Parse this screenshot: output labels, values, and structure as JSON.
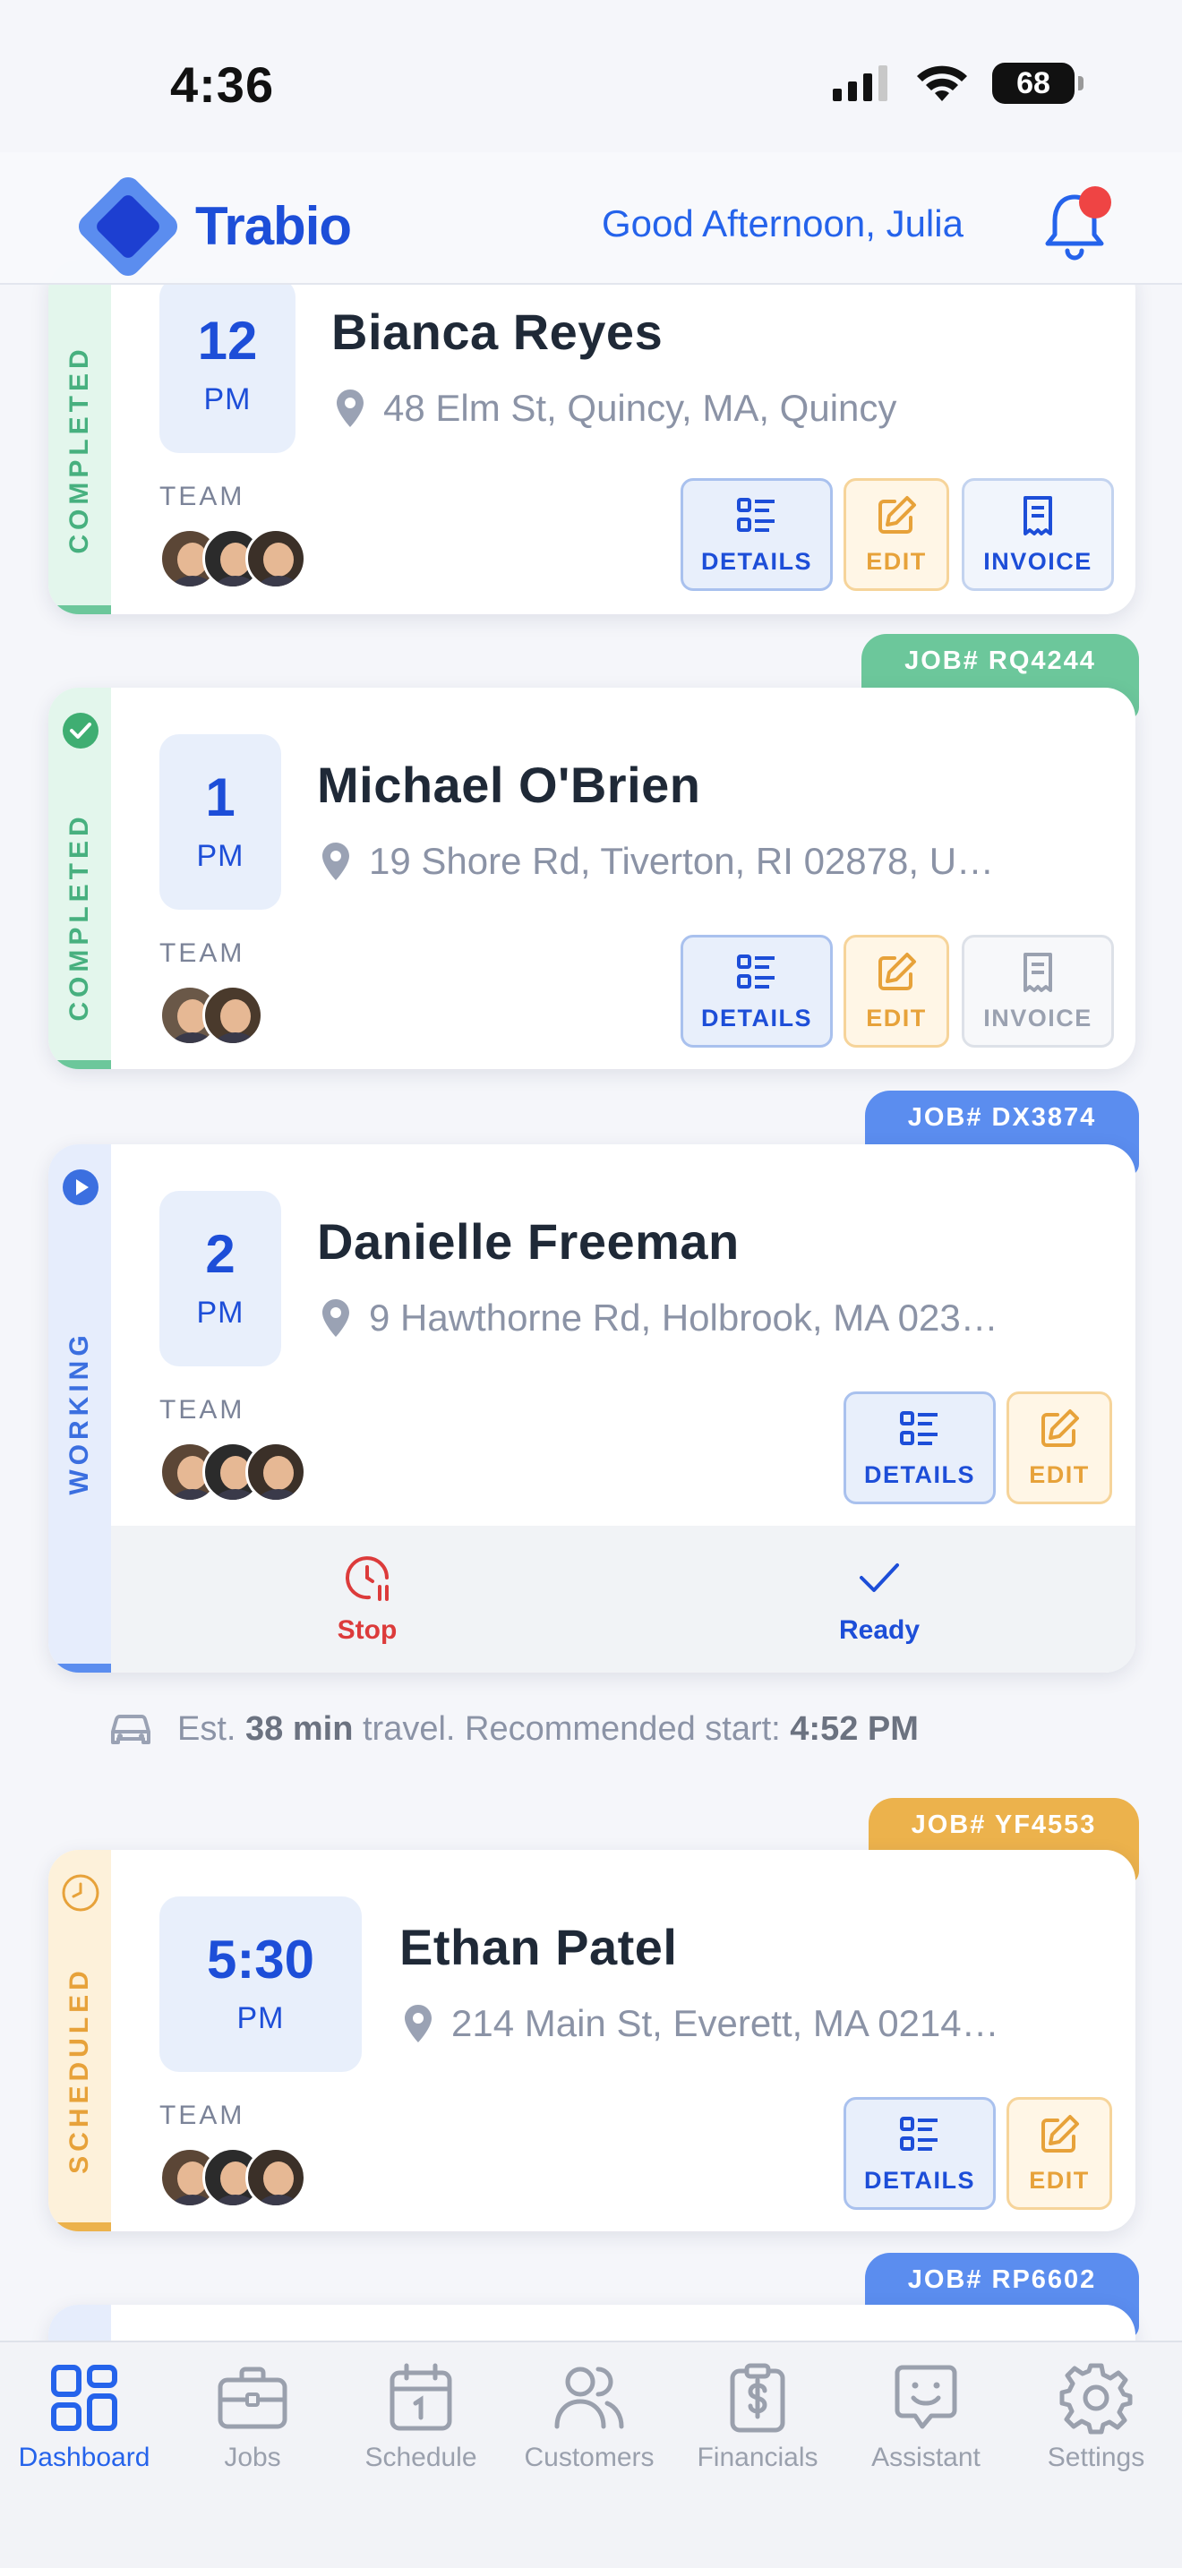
{
  "status": {
    "time": "4:36",
    "battery": "68"
  },
  "header": {
    "app_name": "Trabio",
    "greeting": "Good Afternoon, Julia"
  },
  "colors": {
    "completed": "#6cc79b",
    "working": "#5b8def",
    "scheduled": "#ecb24c",
    "primary": "#1d4ed8"
  },
  "jobs": [
    {
      "status": "COMPLETED",
      "time": "12",
      "ampm": "PM",
      "client": "Bianca Reyes",
      "address": "48 Elm St, Quincy, MA, Quincy",
      "team_label": "TEAM",
      "buttons": {
        "details": "DETAILS",
        "edit": "EDIT",
        "invoice": "INVOICE"
      }
    },
    {
      "job_number": "JOB# RQ4244",
      "status": "COMPLETED",
      "time": "1",
      "ampm": "PM",
      "client": "Michael O'Brien",
      "address": "19 Shore Rd, Tiverton, RI 02878, U…",
      "team_label": "TEAM",
      "buttons": {
        "details": "DETAILS",
        "edit": "EDIT",
        "invoice": "INVOICE"
      }
    },
    {
      "job_number": "JOB# DX3874",
      "status": "WORKING",
      "time": "2",
      "ampm": "PM",
      "client": "Danielle Freeman",
      "address": "9 Hawthorne Rd, Holbrook, MA 023…",
      "team_label": "TEAM",
      "buttons": {
        "details": "DETAILS",
        "edit": "EDIT"
      },
      "actions": {
        "stop": "Stop",
        "ready": "Ready"
      }
    },
    {
      "job_number": "JOB# YF4553",
      "status": "SCHEDULED",
      "time": "5:30",
      "ampm": "PM",
      "client": "Ethan Patel",
      "address": "214 Main St, Everett, MA 0214…",
      "team_label": "TEAM",
      "buttons": {
        "details": "DETAILS",
        "edit": "EDIT"
      }
    },
    {
      "job_number": "JOB# RP6602"
    }
  ],
  "travel": {
    "prefix": "Est.",
    "duration": "38 min",
    "middle": "travel. Recommended start:",
    "start_time": "4:52 PM"
  },
  "tabs": [
    {
      "label": "Dashboard",
      "icon": "grid-icon",
      "active": true
    },
    {
      "label": "Jobs",
      "icon": "briefcase-icon"
    },
    {
      "label": "Schedule",
      "icon": "calendar-icon"
    },
    {
      "label": "Customers",
      "icon": "users-icon"
    },
    {
      "label": "Financials",
      "icon": "dollar-clipboard-icon"
    },
    {
      "label": "Assistant",
      "icon": "chat-smile-icon"
    },
    {
      "label": "Settings",
      "icon": "gear-icon"
    }
  ]
}
